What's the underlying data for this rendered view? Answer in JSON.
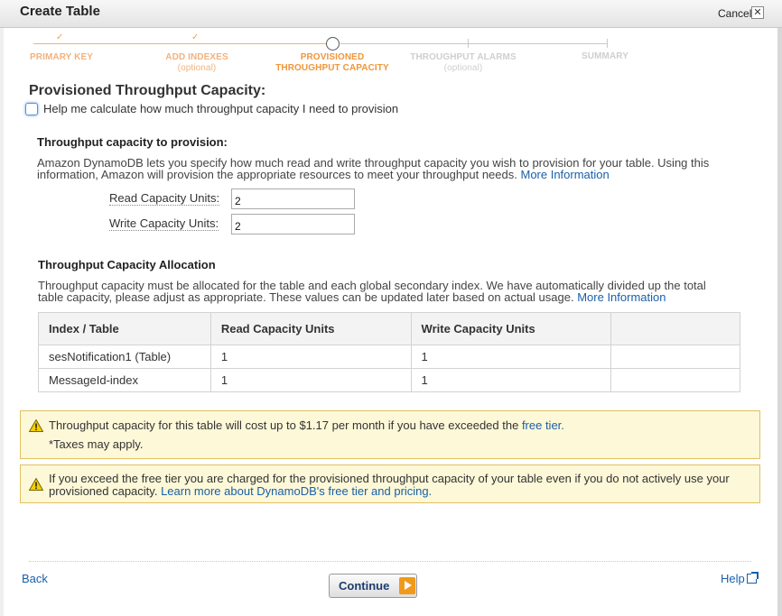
{
  "dialog": {
    "title": "Create Table",
    "cancel_label": "Cancel",
    "close_glyph": "✕"
  },
  "wizard": {
    "steps": [
      {
        "label": "PRIMARY KEY",
        "sub": "",
        "state": "done"
      },
      {
        "label": "ADD INDEXES",
        "sub": "(optional)",
        "state": "done"
      },
      {
        "label": "PROVISIONED",
        "label2": "THROUGHPUT CAPACITY",
        "sub": "",
        "state": "current"
      },
      {
        "label": "THROUGHPUT ALARMS",
        "sub": "(optional)",
        "state": "todo"
      },
      {
        "label": "SUMMARY",
        "sub": "",
        "state": "todo"
      }
    ],
    "check_glyph": "✓"
  },
  "main": {
    "heading": "Provisioned Throughput Capacity:",
    "help_checkbox_label": "Help me calculate how much throughput capacity I need to provision",
    "provision": {
      "heading": "Throughput capacity to provision:",
      "desc_line1": "Amazon DynamoDB lets you specify how much read and write throughput capacity you wish to provision for your table. Using this",
      "desc_line2": "information, Amazon will provision the appropriate resources to meet your throughput needs.",
      "more_info": "More Information",
      "read_label": "Read Capacity Units:",
      "read_value": "2",
      "write_label": "Write Capacity Units:",
      "write_value": "2"
    },
    "allocation": {
      "heading": "Throughput Capacity Allocation",
      "desc_line1": "Throughput capacity must be allocated for the table and each global secondary index. We have automatically divided up the total",
      "desc_line2": "table capacity, please adjust as appropriate. These values can be updated later based on actual usage.",
      "more_info": "More Information",
      "columns": [
        "Index / Table",
        "Read Capacity Units",
        "Write Capacity Units",
        ""
      ],
      "rows": [
        [
          "sesNotification1 (Table)",
          "1",
          "1",
          ""
        ],
        [
          "MessageId-index",
          "1",
          "1",
          ""
        ]
      ]
    },
    "cost_warning": {
      "text": "Throughput capacity for this table will cost up to $1.17 per month if you have exceeded the",
      "link": "free tier.",
      "taxes": "*Taxes may apply."
    },
    "free_tier_warning": {
      "line1": "If you exceed the free tier you are charged for the provisioned throughput capacity of your table even if you do not actively use your",
      "line2_prefix": "provisioned capacity.",
      "link": "Learn more about DynamoDB's free tier and pricing."
    }
  },
  "footer": {
    "back": "Back",
    "continue": "Continue",
    "help": "Help"
  },
  "colors": {
    "link": "#1a5fa8",
    "wizard_done": "#f2b27d",
    "wizard_current": "#f0963b",
    "warning_bg": "#fdf8d8",
    "warning_border": "#e0c060"
  }
}
